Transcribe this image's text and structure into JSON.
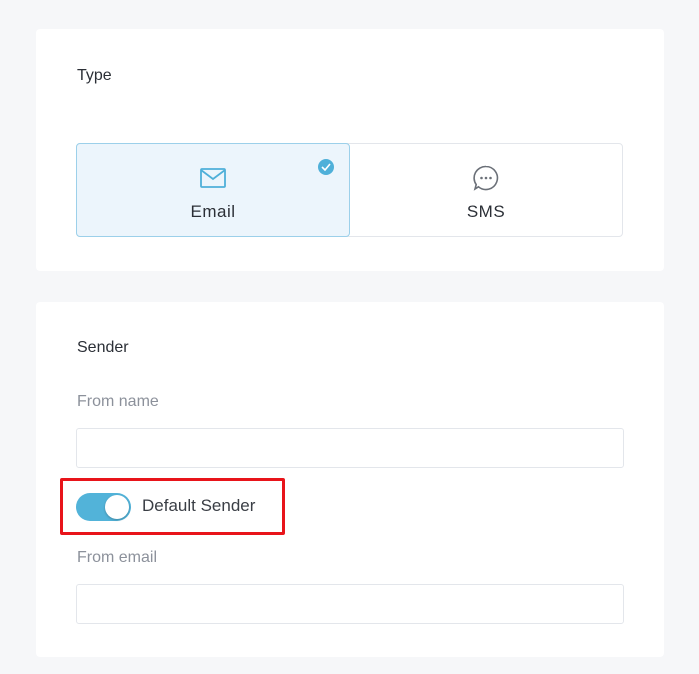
{
  "type_section": {
    "title": "Type",
    "options": [
      {
        "label": "Email",
        "icon": "envelope-icon",
        "selected": true
      },
      {
        "label": "SMS",
        "icon": "chat-bubble-icon",
        "selected": false
      }
    ]
  },
  "sender_section": {
    "title": "Sender",
    "from_name": {
      "label": "From name",
      "value": "",
      "placeholder": ""
    },
    "default_sender": {
      "label": "Default Sender",
      "enabled": true
    },
    "from_email": {
      "label": "From email",
      "value": "",
      "placeholder": ""
    }
  },
  "colors": {
    "accent": "#52b3d9",
    "selected_bg": "#ecf5fc",
    "highlight": "#e8141a"
  }
}
